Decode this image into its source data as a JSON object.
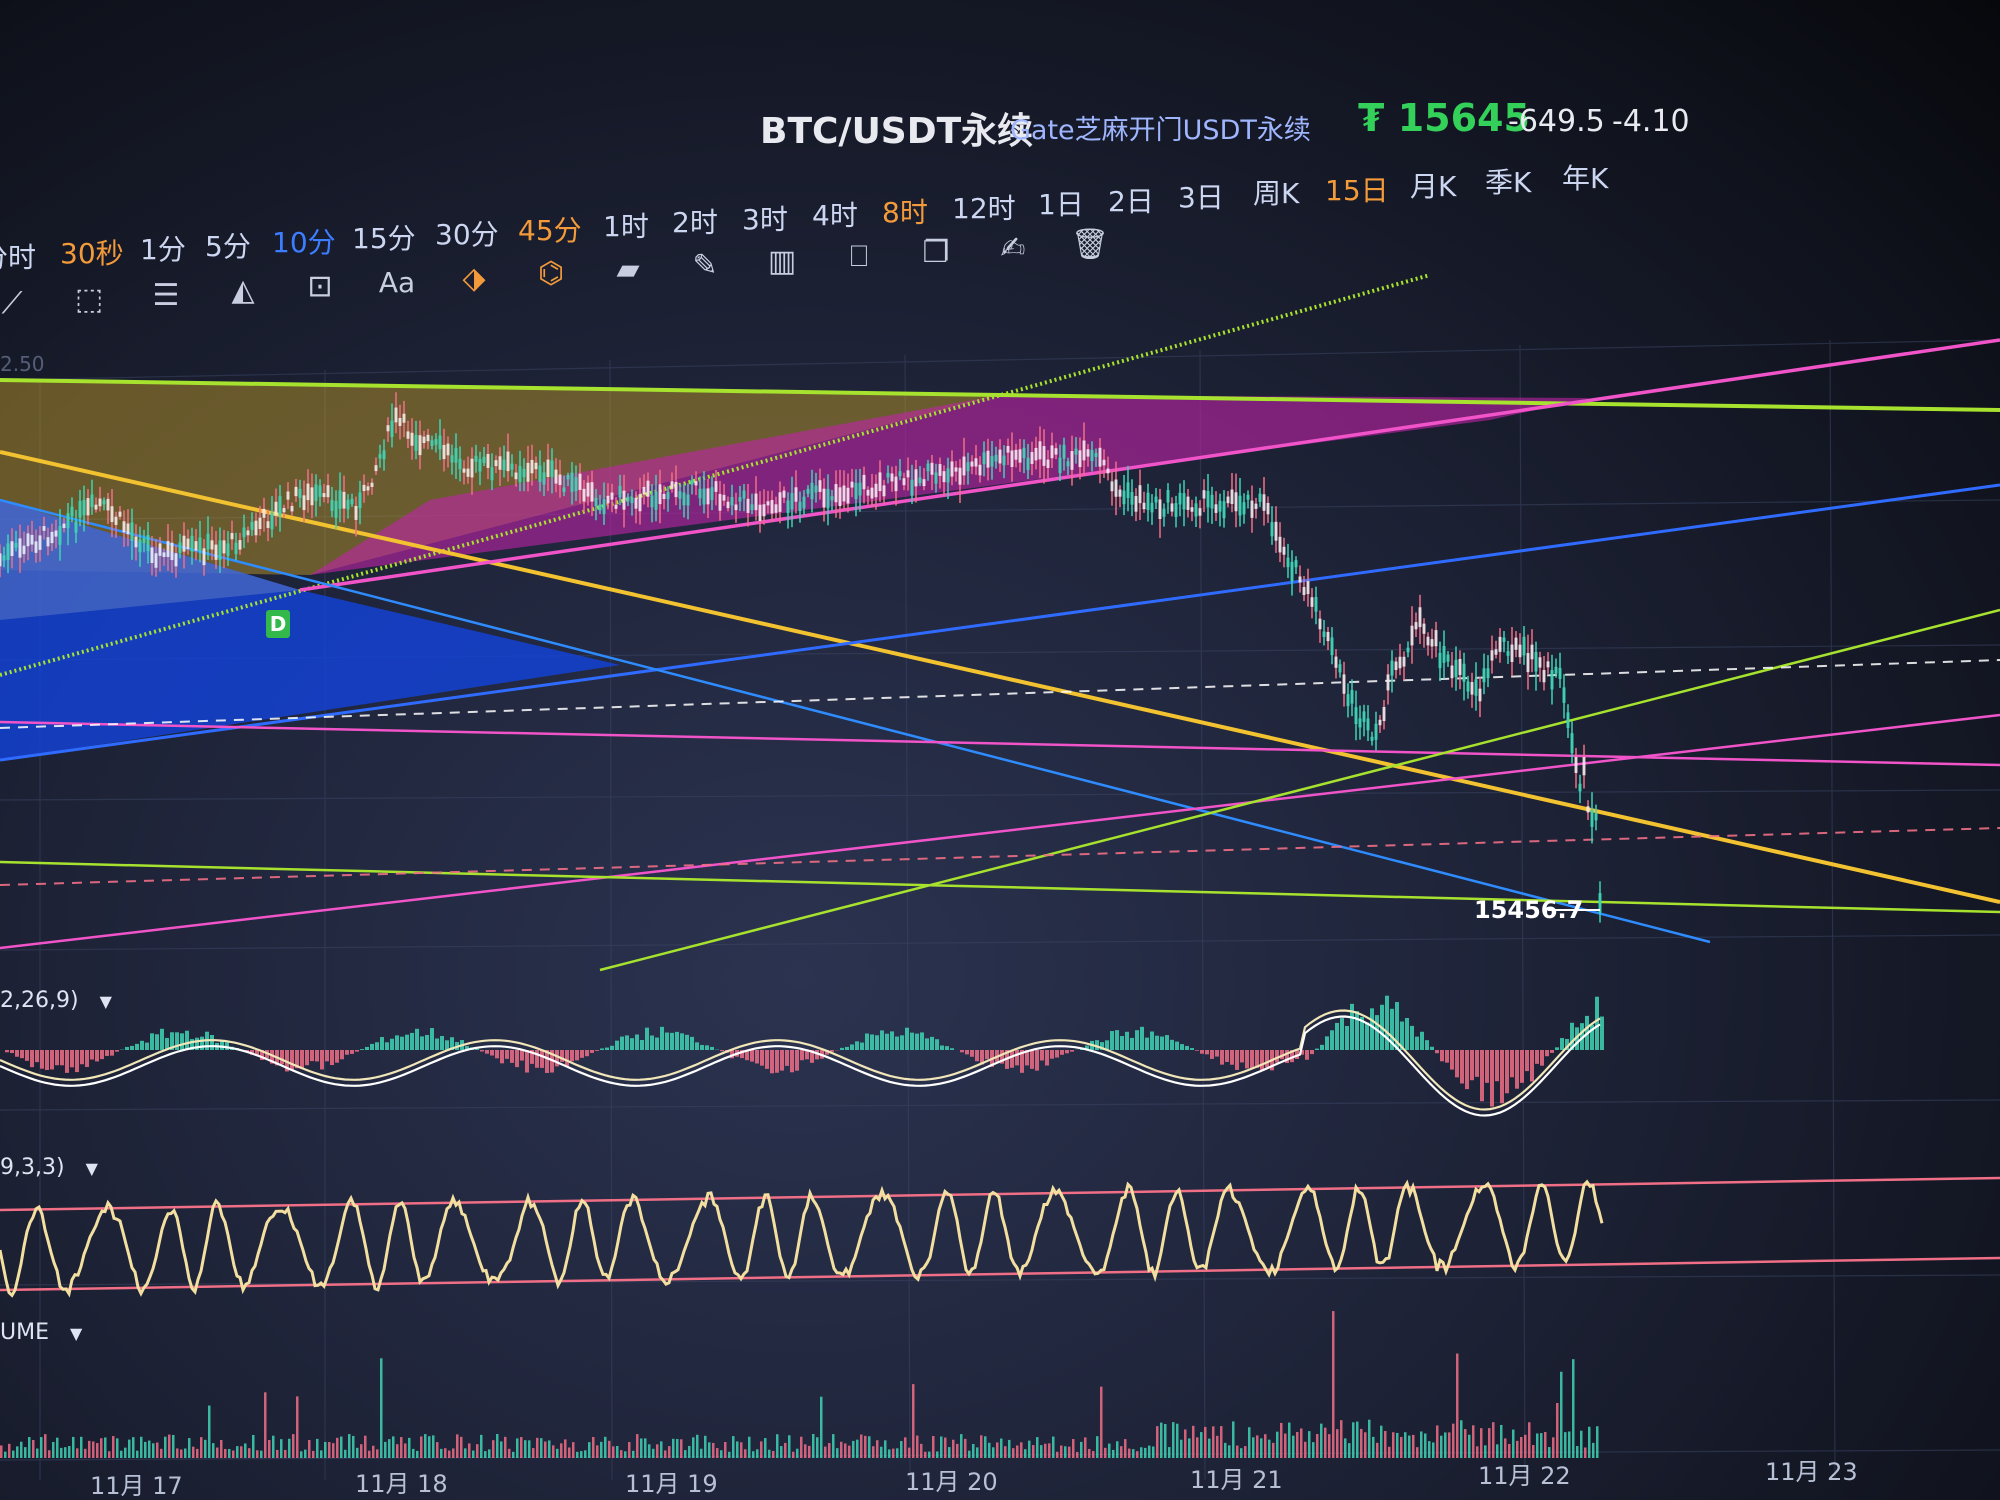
{
  "header": {
    "pair": "BTC/USDT永续",
    "exchange": "Gate芝麻开门USDT永续",
    "last_price": "15645",
    "price_change": "-649.5",
    "pct_change": "-4.10",
    "currency_icon": "tether-icon"
  },
  "intervals": [
    {
      "label": "分时",
      "color": "default"
    },
    {
      "label": "30秒",
      "color": "orange"
    },
    {
      "label": "1分",
      "color": "default"
    },
    {
      "label": "5分",
      "color": "default"
    },
    {
      "label": "10分",
      "color": "blue",
      "selected": true
    },
    {
      "label": "15分",
      "color": "default"
    },
    {
      "label": "30分",
      "color": "default"
    },
    {
      "label": "45分",
      "color": "orange"
    },
    {
      "label": "1时",
      "color": "default"
    },
    {
      "label": "2时",
      "color": "default"
    },
    {
      "label": "3时",
      "color": "default"
    },
    {
      "label": "4时",
      "color": "default"
    },
    {
      "label": "8时",
      "color": "orange"
    },
    {
      "label": "12时",
      "color": "default"
    },
    {
      "label": "1日",
      "color": "default"
    },
    {
      "label": "2日",
      "color": "default"
    },
    {
      "label": "3日",
      "color": "default"
    },
    {
      "label": "周K",
      "color": "default"
    },
    {
      "label": "15日",
      "color": "orange"
    },
    {
      "label": "月K",
      "color": "default"
    },
    {
      "label": "季K",
      "color": "default"
    },
    {
      "label": "年K",
      "color": "default"
    }
  ],
  "tools": [
    {
      "name": "line-tool-icon"
    },
    {
      "name": "channel-tool-icon"
    },
    {
      "name": "fib-lines-icon"
    },
    {
      "name": "pattern-tool-icon"
    },
    {
      "name": "measure-tool-icon"
    },
    {
      "name": "text-tool-icon",
      "label": "Aa"
    },
    {
      "name": "eraser-icon"
    },
    {
      "name": "magnet-icon"
    },
    {
      "name": "ruler-icon"
    },
    {
      "name": "pen-icon"
    },
    {
      "name": "candles-icon"
    },
    {
      "name": "lock-icon"
    },
    {
      "name": "copy-icon"
    },
    {
      "name": "edit-icon"
    },
    {
      "name": "trash-icon"
    }
  ],
  "chart": {
    "price_marker": "15456.7",
    "badge": "D",
    "top_axis_price": "2.50",
    "x_axis_labels": [
      "11月 17",
      "11月 18",
      "11月 19",
      "11月 20",
      "11月 21",
      "11月 22",
      "11月 23"
    ],
    "panes": {
      "macd_label": "2,26,9)",
      "kdj_label": "9,3,3)",
      "volume_label": "UME"
    },
    "colors": {
      "up": "#3fd3b4",
      "down": "#f06f86",
      "yellow_line": "#f2c230",
      "green_line": "#a6e22e",
      "pink_line": "#f054c8",
      "blue_line": "#2f6bff",
      "price": "#34d15a"
    }
  }
}
